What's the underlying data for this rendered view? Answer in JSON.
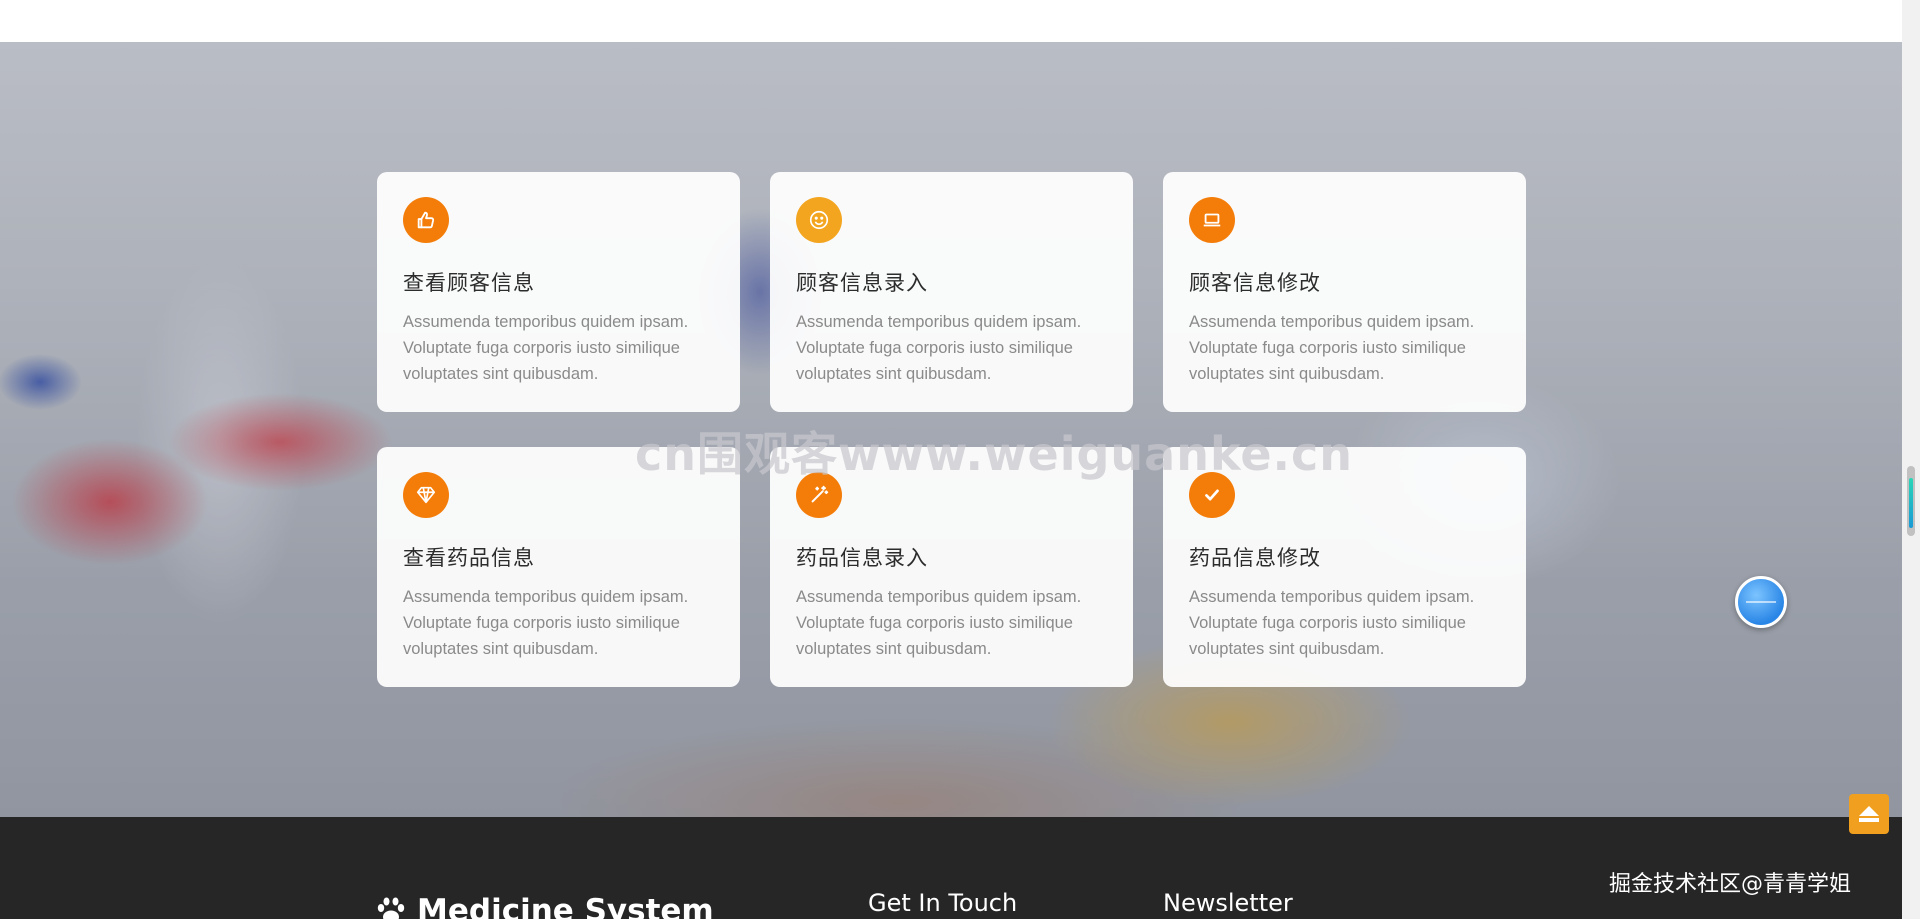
{
  "features": [
    {
      "icon": "thumbs-up-icon",
      "title": "查看顾客信息",
      "text": "Assumenda temporibus quidem ipsam. Voluptate fuga corporis iusto similique voluptates sint quibusdam."
    },
    {
      "icon": "smile-icon",
      "title": "顾客信息录入",
      "text": "Assumenda temporibus quidem ipsam. Voluptate fuga corporis iusto similique voluptates sint quibusdam."
    },
    {
      "icon": "laptop-icon",
      "title": "顾客信息修改",
      "text": "Assumenda temporibus quidem ipsam. Voluptate fuga corporis iusto similique voluptates sint quibusdam."
    },
    {
      "icon": "diamond-icon",
      "title": "查看药品信息",
      "text": "Assumenda temporibus quidem ipsam. Voluptate fuga corporis iusto similique voluptates sint quibusdam."
    },
    {
      "icon": "magic-wand-icon",
      "title": "药品信息录入",
      "text": "Assumenda temporibus quidem ipsam. Voluptate fuga corporis iusto similique voluptates sint quibusdam."
    },
    {
      "icon": "check-circle-icon",
      "title": "药品信息修改",
      "text": "Assumenda temporibus quidem ipsam. Voluptate fuga corporis iusto similique voluptates sint quibusdam."
    }
  ],
  "watermark": "cn围观客www.weiguanke.cn",
  "footer": {
    "brand": "Medicine System",
    "get_in_touch": "Get In Touch",
    "newsletter": "Newsletter"
  },
  "attribution": "掘金技术社区@青青学姐",
  "colors": {
    "accent": "#f47d0a",
    "accent_alt": "#f3a51f",
    "footer_bg": "#262626",
    "back_to_top": "#f0a01e"
  }
}
